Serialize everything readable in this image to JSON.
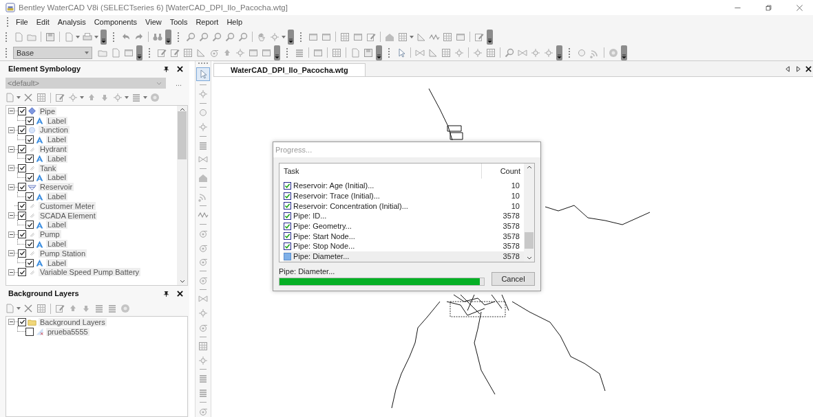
{
  "window": {
    "title": "Bentley WaterCAD V8i (SELECTseries 6) [WaterCAD_DPI_Ilo_Pacocha.wtg]"
  },
  "menu": [
    "File",
    "Edit",
    "Analysis",
    "Components",
    "View",
    "Tools",
    "Report",
    "Help"
  ],
  "toolbar": {
    "style_dropdown": "Base"
  },
  "element_symbology": {
    "title": "Element Symbology",
    "scheme_dropdown": "<default>",
    "more_button": "...",
    "tree": [
      {
        "label": "Pipe",
        "checked": true,
        "expanded": true,
        "children": [
          {
            "label": "Label",
            "checked": true
          }
        ]
      },
      {
        "label": "Junction",
        "checked": true,
        "expanded": true,
        "children": [
          {
            "label": "Label",
            "checked": true
          }
        ]
      },
      {
        "label": "Hydrant",
        "checked": true,
        "expanded": true,
        "children": [
          {
            "label": "Label",
            "checked": true
          }
        ]
      },
      {
        "label": "Tank",
        "checked": true,
        "expanded": true,
        "children": [
          {
            "label": "Label",
            "checked": true
          }
        ]
      },
      {
        "label": "Reservoir",
        "checked": true,
        "expanded": true,
        "children": [
          {
            "label": "Label",
            "checked": true
          }
        ]
      },
      {
        "label": "Customer Meter",
        "checked": true
      },
      {
        "label": "SCADA Element",
        "checked": true,
        "expanded": true,
        "children": [
          {
            "label": "Label",
            "checked": true
          }
        ]
      },
      {
        "label": "Pump",
        "checked": true,
        "expanded": true,
        "children": [
          {
            "label": "Label",
            "checked": true
          }
        ]
      },
      {
        "label": "Pump Station",
        "checked": true,
        "expanded": true,
        "children": [
          {
            "label": "Label",
            "checked": true
          }
        ]
      },
      {
        "label": "Variable Speed Pump Battery",
        "checked": true,
        "expanded": true
      }
    ]
  },
  "background_layers": {
    "title": "Background Layers",
    "tree": [
      {
        "label": "Background Layers",
        "checked": true,
        "expanded": true,
        "children": [
          {
            "label": "prueba5555",
            "checked": false
          }
        ]
      }
    ]
  },
  "document_tab": {
    "label": "WaterCAD_DPI_Ilo_Pacocha.wtg",
    "selected": true
  },
  "progress_dialog": {
    "title": "Progress...",
    "columns": [
      "Task",
      "Count"
    ],
    "rows": [
      {
        "task": "Reservoir: Age (Initial)...",
        "count": "10",
        "done": true,
        "selected": false
      },
      {
        "task": "Reservoir: Trace (Initial)...",
        "count": "10",
        "done": true,
        "selected": false
      },
      {
        "task": "Reservoir: Concentration (Initial)...",
        "count": "10",
        "done": true,
        "selected": false
      },
      {
        "task": "Pipe: ID...",
        "count": "3578",
        "done": true,
        "selected": false
      },
      {
        "task": "Pipe: Geometry...",
        "count": "3578",
        "done": true,
        "selected": false
      },
      {
        "task": "Pipe: Start Node...",
        "count": "3578",
        "done": true,
        "selected": false
      },
      {
        "task": "Pipe: Stop Node...",
        "count": "3578",
        "done": true,
        "selected": false
      },
      {
        "task": "Pipe: Diameter...",
        "count": "3578",
        "done": false,
        "selected": true
      }
    ],
    "status": "Pipe: Diameter...",
    "level": 0.98,
    "cancel_button": "Cancel"
  }
}
